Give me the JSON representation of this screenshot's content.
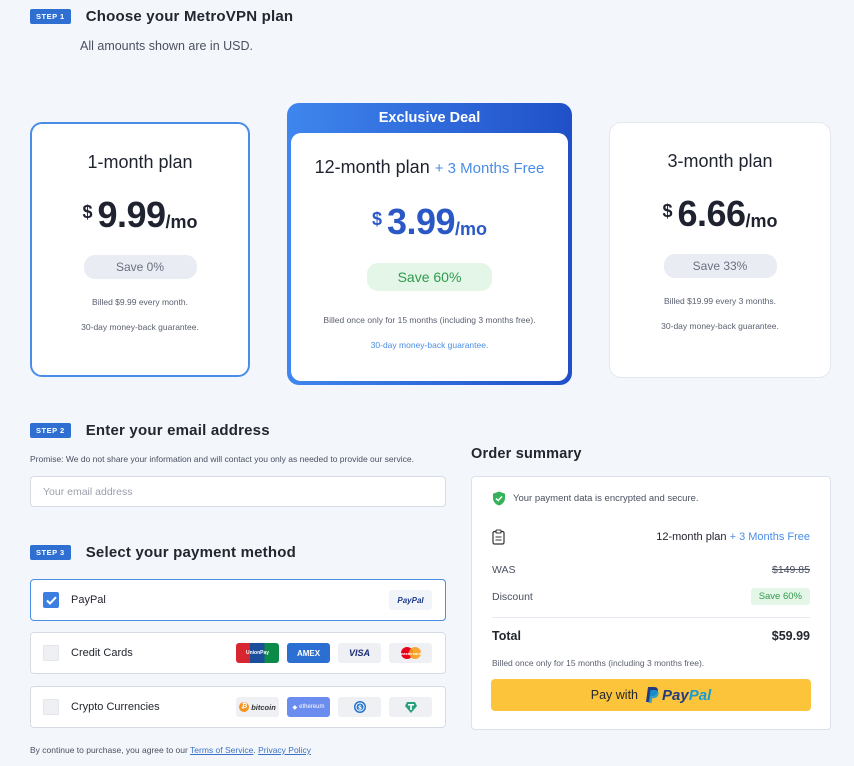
{
  "steps": [
    {
      "badge": "STEP 1",
      "title": "Choose your MetroVPN plan"
    },
    {
      "badge": "STEP 2",
      "title": "Enter your email address"
    },
    {
      "badge": "STEP 3",
      "title": "Select your payment method"
    }
  ],
  "subtitle": "All amounts shown are in USD.",
  "plans": {
    "one": {
      "name": "1-month plan",
      "currency": "$",
      "amount": "9.99",
      "per": "/mo",
      "save": "Save 0%",
      "note1": "Billed $9.99 every month.",
      "note2": "30-day money-back guarantee."
    },
    "twelve": {
      "ribbon": "Exclusive Deal",
      "name": "12-month plan",
      "extra": "+ 3 Months Free",
      "currency": "$",
      "amount": "3.99",
      "per": "/mo",
      "save": "Save 60%",
      "note1": "Billed once only for 15 months (including 3 months free).",
      "note2": "30-day money-back guarantee."
    },
    "three": {
      "name": "3-month plan",
      "currency": "$",
      "amount": "6.66",
      "per": "/mo",
      "save": "Save 33%",
      "note1": "Billed $19.99 every 3 months.",
      "note2": "30-day money-back guarantee."
    }
  },
  "email": {
    "promise": "Promise: We do not share your information and will contact you only as needed to provide our service.",
    "placeholder": "Your email address"
  },
  "payment": {
    "paypal": {
      "label": "PayPal",
      "checked": true,
      "logos": [
        "PayPal"
      ]
    },
    "cards": {
      "label": "Credit Cards",
      "checked": false,
      "logos": [
        "UnionPay",
        "AMEX",
        "VISA",
        "mastercard"
      ]
    },
    "crypto": {
      "label": "Crypto Currencies",
      "checked": false,
      "logos": [
        "bitcoin",
        "ethereum",
        "usd-coin-icon",
        "tether-icon"
      ]
    }
  },
  "terms": {
    "prefix": "By continue to purchase, you agree to our ",
    "tos": "Terms of Service",
    "sep": ". ",
    "privacy": "Privacy Policy"
  },
  "summary": {
    "title": "Order summary",
    "secure": "Your payment data is encrypted and secure.",
    "plan_name": "12-month plan",
    "plan_extra": "+ 3 Months Free",
    "was_label": "WAS",
    "was_value": "$149.85",
    "discount_label": "Discount",
    "discount_value": "Save 60%",
    "total_label": "Total",
    "total_value": "$59.99",
    "note": "Billed once only for 15 months (including 3 months free).",
    "pay_label": "Pay with",
    "pay_brand_1": "Pay",
    "pay_brand_2": "Pal"
  },
  "colors": {
    "accent": "#2f6fd1",
    "highlight": "#4a8de6",
    "success": "#2e9b4b",
    "paypal_button": "#fcc43a"
  }
}
